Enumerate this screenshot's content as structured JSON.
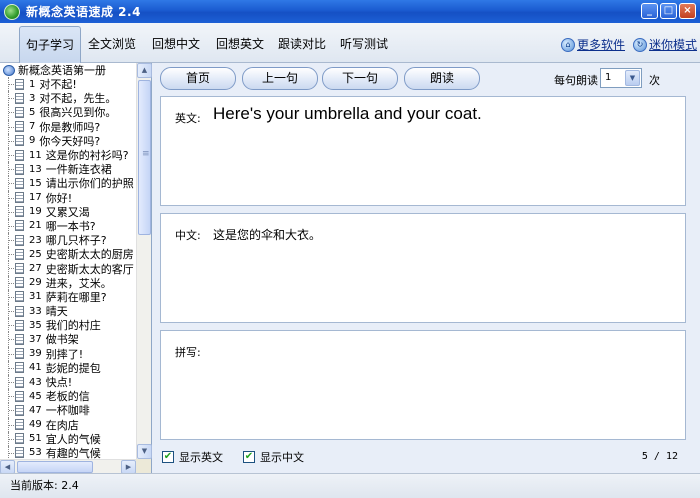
{
  "window": {
    "title": "新概念英语速成 2.4",
    "controls": [
      "_",
      "□",
      "×"
    ]
  },
  "tabs": [
    {
      "label": "句子学习",
      "active": true
    },
    {
      "label": "全文浏览",
      "active": false
    },
    {
      "label": "回想中文",
      "active": false
    },
    {
      "label": "回想英文",
      "active": false
    },
    {
      "label": "跟读对比",
      "active": false
    },
    {
      "label": "听写测试",
      "active": false
    }
  ],
  "links": {
    "more_software": "更多软件",
    "mini_mode": "迷你模式"
  },
  "tree": {
    "root": "新概念英语第一册",
    "items": [
      {
        "num": "1",
        "text": "对不起!"
      },
      {
        "num": "3",
        "text": "对不起，先生。"
      },
      {
        "num": "5",
        "text": "很高兴见到你。"
      },
      {
        "num": "7",
        "text": "你是教师吗?"
      },
      {
        "num": "9",
        "text": "你今天好吗?"
      },
      {
        "num": "11",
        "text": "这是你的衬衫吗?"
      },
      {
        "num": "13",
        "text": "一件新连衣裙"
      },
      {
        "num": "15",
        "text": "请出示你们的护照"
      },
      {
        "num": "17",
        "text": "你好!"
      },
      {
        "num": "19",
        "text": "又累又渴"
      },
      {
        "num": "21",
        "text": "哪一本书?"
      },
      {
        "num": "23",
        "text": "哪几只杯子?"
      },
      {
        "num": "25",
        "text": "史密斯太太的厨房"
      },
      {
        "num": "27",
        "text": "史密斯太太的客厅"
      },
      {
        "num": "29",
        "text": "进来，艾米。"
      },
      {
        "num": "31",
        "text": "萨莉在哪里?"
      },
      {
        "num": "33",
        "text": "晴天"
      },
      {
        "num": "35",
        "text": "我们的村庄"
      },
      {
        "num": "37",
        "text": "做书架"
      },
      {
        "num": "39",
        "text": "别摔了!"
      },
      {
        "num": "41",
        "text": "彭妮的提包"
      },
      {
        "num": "43",
        "text": "快点!"
      },
      {
        "num": "45",
        "text": "老板的信"
      },
      {
        "num": "47",
        "text": "一杯咖啡"
      },
      {
        "num": "49",
        "text": "在肉店"
      },
      {
        "num": "51",
        "text": "宜人的气候"
      },
      {
        "num": "53",
        "text": "有趣的气候"
      }
    ]
  },
  "toolbar": {
    "first": "首页",
    "prev": "上一句",
    "next": "下一句",
    "read": "朗读",
    "repeat_label": "每句朗读",
    "repeat_value": "1",
    "times_label": "次"
  },
  "english": {
    "label": "英文:",
    "text": "Here's your umbrella and your coat."
  },
  "chinese": {
    "label": "中文:",
    "text": "这是您的伞和大衣。"
  },
  "dictation": {
    "label": "拼写:",
    "value": ""
  },
  "options": {
    "show_english": "显示英文",
    "show_chinese": "显示中文",
    "show_english_checked": true,
    "show_chinese_checked": true
  },
  "progress": "5 / 12",
  "status": {
    "version": "当前版本: 2.4"
  }
}
